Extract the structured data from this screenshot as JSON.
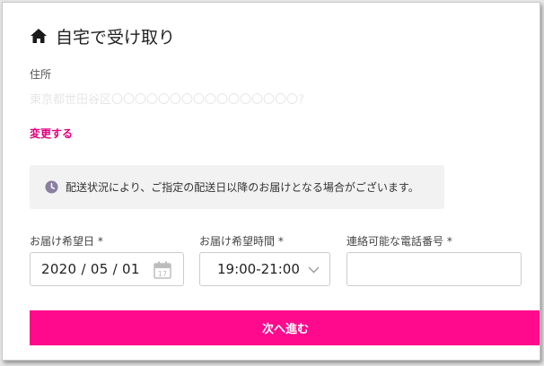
{
  "header": {
    "title": "自宅で受け取り",
    "icon": "home-icon"
  },
  "address": {
    "label": "住所",
    "value": "東京都世田谷区〇〇〇〇〇〇〇〇〇〇〇〇〇〇〇〇?",
    "change_link": "変更する"
  },
  "notice": {
    "text": "配送状況により、ご指定の配送日以降のお届けとなる場合がございます。",
    "icon": "clock-icon"
  },
  "delivery_date": {
    "label": "お届け希望日 *",
    "value": "2020 / 05 / 01",
    "icon": "calendar-icon"
  },
  "delivery_time": {
    "label": "お届け希望時間 *",
    "value": "19:00-21:00",
    "icon": "chevron-down-icon"
  },
  "phone": {
    "label": "連絡可能な電話番号 *",
    "value": "",
    "placeholder": ""
  },
  "actions": {
    "next_label": "次へ進む"
  },
  "colors": {
    "accent": "#ff0a8c",
    "link": "#e5007e",
    "notice_bg": "#f2f2f2"
  }
}
